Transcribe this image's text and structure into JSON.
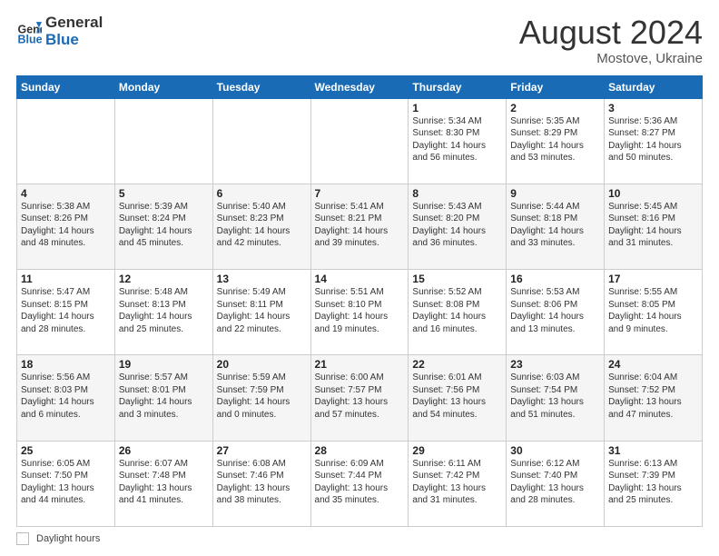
{
  "header": {
    "logo_line1": "General",
    "logo_line2": "Blue",
    "month": "August 2024",
    "location": "Mostove, Ukraine"
  },
  "weekdays": [
    "Sunday",
    "Monday",
    "Tuesday",
    "Wednesday",
    "Thursday",
    "Friday",
    "Saturday"
  ],
  "weeks": [
    [
      {
        "day": "",
        "info": ""
      },
      {
        "day": "",
        "info": ""
      },
      {
        "day": "",
        "info": ""
      },
      {
        "day": "",
        "info": ""
      },
      {
        "day": "1",
        "info": "Sunrise: 5:34 AM\nSunset: 8:30 PM\nDaylight: 14 hours\nand 56 minutes."
      },
      {
        "day": "2",
        "info": "Sunrise: 5:35 AM\nSunset: 8:29 PM\nDaylight: 14 hours\nand 53 minutes."
      },
      {
        "day": "3",
        "info": "Sunrise: 5:36 AM\nSunset: 8:27 PM\nDaylight: 14 hours\nand 50 minutes."
      }
    ],
    [
      {
        "day": "4",
        "info": "Sunrise: 5:38 AM\nSunset: 8:26 PM\nDaylight: 14 hours\nand 48 minutes."
      },
      {
        "day": "5",
        "info": "Sunrise: 5:39 AM\nSunset: 8:24 PM\nDaylight: 14 hours\nand 45 minutes."
      },
      {
        "day": "6",
        "info": "Sunrise: 5:40 AM\nSunset: 8:23 PM\nDaylight: 14 hours\nand 42 minutes."
      },
      {
        "day": "7",
        "info": "Sunrise: 5:41 AM\nSunset: 8:21 PM\nDaylight: 14 hours\nand 39 minutes."
      },
      {
        "day": "8",
        "info": "Sunrise: 5:43 AM\nSunset: 8:20 PM\nDaylight: 14 hours\nand 36 minutes."
      },
      {
        "day": "9",
        "info": "Sunrise: 5:44 AM\nSunset: 8:18 PM\nDaylight: 14 hours\nand 33 minutes."
      },
      {
        "day": "10",
        "info": "Sunrise: 5:45 AM\nSunset: 8:16 PM\nDaylight: 14 hours\nand 31 minutes."
      }
    ],
    [
      {
        "day": "11",
        "info": "Sunrise: 5:47 AM\nSunset: 8:15 PM\nDaylight: 14 hours\nand 28 minutes."
      },
      {
        "day": "12",
        "info": "Sunrise: 5:48 AM\nSunset: 8:13 PM\nDaylight: 14 hours\nand 25 minutes."
      },
      {
        "day": "13",
        "info": "Sunrise: 5:49 AM\nSunset: 8:11 PM\nDaylight: 14 hours\nand 22 minutes."
      },
      {
        "day": "14",
        "info": "Sunrise: 5:51 AM\nSunset: 8:10 PM\nDaylight: 14 hours\nand 19 minutes."
      },
      {
        "day": "15",
        "info": "Sunrise: 5:52 AM\nSunset: 8:08 PM\nDaylight: 14 hours\nand 16 minutes."
      },
      {
        "day": "16",
        "info": "Sunrise: 5:53 AM\nSunset: 8:06 PM\nDaylight: 14 hours\nand 13 minutes."
      },
      {
        "day": "17",
        "info": "Sunrise: 5:55 AM\nSunset: 8:05 PM\nDaylight: 14 hours\nand 9 minutes."
      }
    ],
    [
      {
        "day": "18",
        "info": "Sunrise: 5:56 AM\nSunset: 8:03 PM\nDaylight: 14 hours\nand 6 minutes."
      },
      {
        "day": "19",
        "info": "Sunrise: 5:57 AM\nSunset: 8:01 PM\nDaylight: 14 hours\nand 3 minutes."
      },
      {
        "day": "20",
        "info": "Sunrise: 5:59 AM\nSunset: 7:59 PM\nDaylight: 14 hours\nand 0 minutes."
      },
      {
        "day": "21",
        "info": "Sunrise: 6:00 AM\nSunset: 7:57 PM\nDaylight: 13 hours\nand 57 minutes."
      },
      {
        "day": "22",
        "info": "Sunrise: 6:01 AM\nSunset: 7:56 PM\nDaylight: 13 hours\nand 54 minutes."
      },
      {
        "day": "23",
        "info": "Sunrise: 6:03 AM\nSunset: 7:54 PM\nDaylight: 13 hours\nand 51 minutes."
      },
      {
        "day": "24",
        "info": "Sunrise: 6:04 AM\nSunset: 7:52 PM\nDaylight: 13 hours\nand 47 minutes."
      }
    ],
    [
      {
        "day": "25",
        "info": "Sunrise: 6:05 AM\nSunset: 7:50 PM\nDaylight: 13 hours\nand 44 minutes."
      },
      {
        "day": "26",
        "info": "Sunrise: 6:07 AM\nSunset: 7:48 PM\nDaylight: 13 hours\nand 41 minutes."
      },
      {
        "day": "27",
        "info": "Sunrise: 6:08 AM\nSunset: 7:46 PM\nDaylight: 13 hours\nand 38 minutes."
      },
      {
        "day": "28",
        "info": "Sunrise: 6:09 AM\nSunset: 7:44 PM\nDaylight: 13 hours\nand 35 minutes."
      },
      {
        "day": "29",
        "info": "Sunrise: 6:11 AM\nSunset: 7:42 PM\nDaylight: 13 hours\nand 31 minutes."
      },
      {
        "day": "30",
        "info": "Sunrise: 6:12 AM\nSunset: 7:40 PM\nDaylight: 13 hours\nand 28 minutes."
      },
      {
        "day": "31",
        "info": "Sunrise: 6:13 AM\nSunset: 7:39 PM\nDaylight: 13 hours\nand 25 minutes."
      }
    ]
  ],
  "footer": {
    "legend_label": "Daylight hours"
  }
}
